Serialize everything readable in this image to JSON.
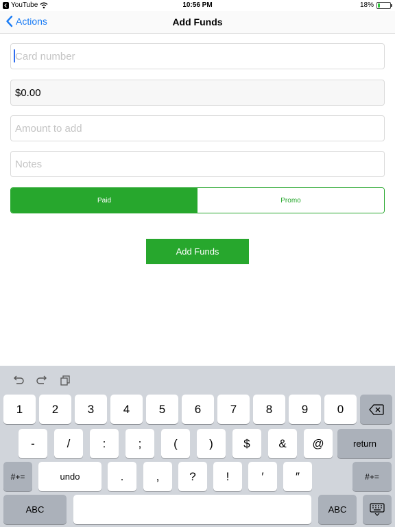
{
  "status_bar": {
    "back_app": "YouTube",
    "time": "10:56 PM",
    "battery_percent": "18%",
    "battery_level": 0.18,
    "icons": [
      "back-app-icon",
      "wifi-icon",
      "battery-icon"
    ]
  },
  "nav": {
    "back_label": "Actions",
    "title": "Add Funds"
  },
  "form": {
    "card_number": {
      "placeholder": "Card number",
      "value": ""
    },
    "balance": {
      "value": "$0.00"
    },
    "amount": {
      "placeholder": "Amount to add",
      "value": ""
    },
    "notes": {
      "placeholder": "Notes",
      "value": ""
    },
    "segments": [
      {
        "label": "Paid",
        "selected": true
      },
      {
        "label": "Promo",
        "selected": false
      }
    ],
    "submit_label": "Add Funds"
  },
  "keyboard": {
    "shortcut_icons": [
      "undo-icon",
      "redo-icon",
      "paste-icon"
    ],
    "row1": [
      "1",
      "2",
      "3",
      "4",
      "5",
      "6",
      "7",
      "8",
      "9",
      "0"
    ],
    "row2": [
      "-",
      "/",
      ":",
      ";",
      "(",
      ")",
      "$",
      "&",
      "@"
    ],
    "return_label": "return",
    "row3_left": "#+=",
    "undo_label": "undo",
    "row3": [
      ".",
      ",",
      "?",
      "!",
      "′",
      "″"
    ],
    "row3_right": "#+=",
    "abc_left": "ABC",
    "abc_right": "ABC",
    "colors": {
      "accent": "#27a72d",
      "link": "#1a7cf5",
      "keyboard_bg": "#d1d5db",
      "dark_key": "#abb1ba"
    }
  }
}
